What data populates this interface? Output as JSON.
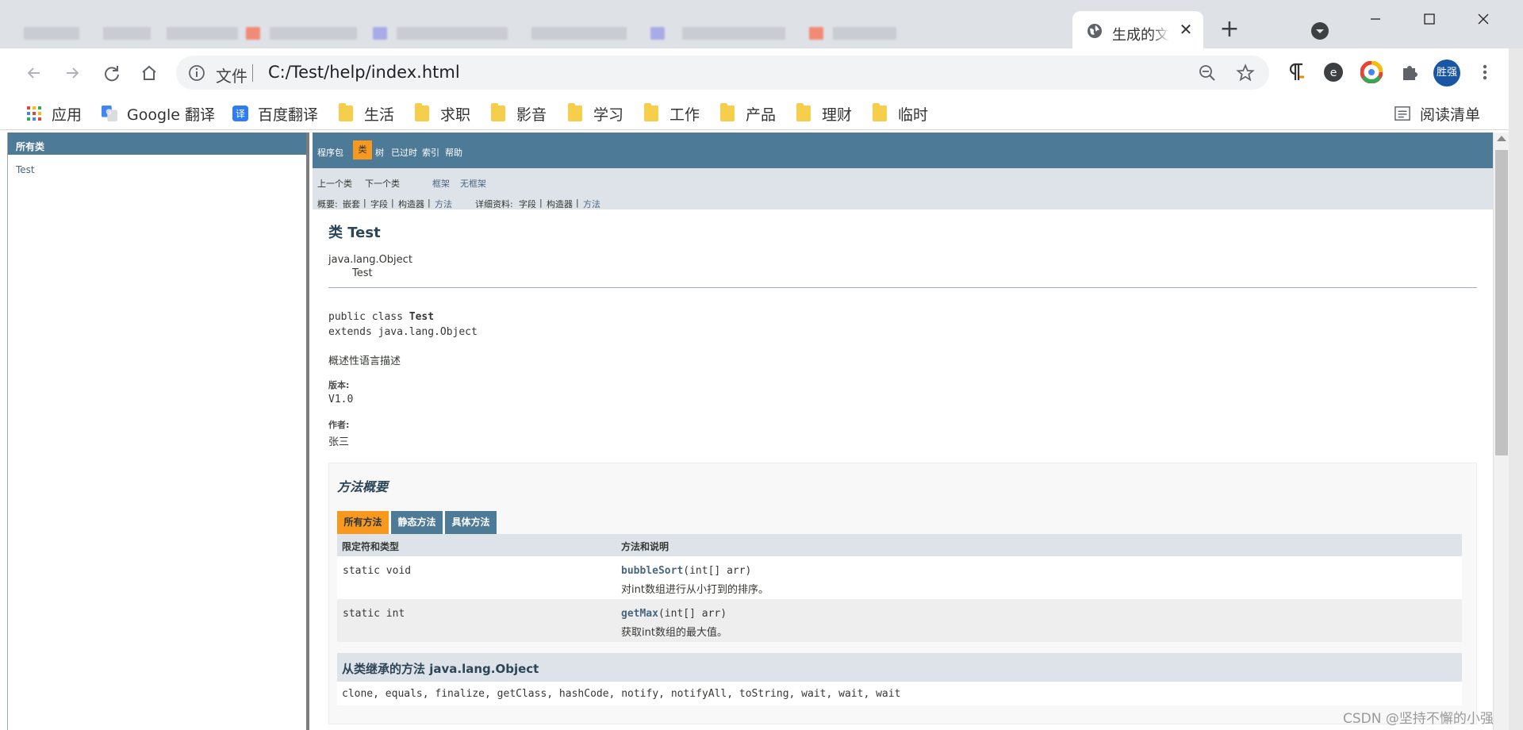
{
  "browser": {
    "tab_title": "生成的文",
    "tab_close": "✕",
    "new_tab": "+",
    "url_scheme": "文件",
    "url": "C:/Test/help/index.html",
    "profile_name": "胜强"
  },
  "bookmarks": [
    {
      "label": "应用",
      "icon": "apps-grid-icon"
    },
    {
      "label": "Google 翻译",
      "icon": "google-translate-icon"
    },
    {
      "label": "百度翻译",
      "icon": "baidu-translate-icon"
    },
    {
      "label": "生活",
      "icon": "folder-icon"
    },
    {
      "label": "求职",
      "icon": "folder-icon"
    },
    {
      "label": "影音",
      "icon": "folder-icon"
    },
    {
      "label": "学习",
      "icon": "folder-icon"
    },
    {
      "label": "工作",
      "icon": "folder-icon"
    },
    {
      "label": "产品",
      "icon": "folder-icon"
    },
    {
      "label": "理财",
      "icon": "folder-icon"
    },
    {
      "label": "临时",
      "icon": "folder-icon"
    }
  ],
  "reading_list": "阅读清单",
  "left_frame": {
    "header": "所有类",
    "classes": [
      "Test"
    ]
  },
  "javadoc": {
    "topnav": {
      "package": "程序包",
      "class": "类",
      "tree": "树",
      "deprecated": "已过时",
      "index": "索引",
      "help": "帮助"
    },
    "subnav": {
      "prev_class": "上一个类",
      "next_class": "下一个类",
      "frames": "框架",
      "no_frames": "无框架",
      "summary_label": "概要:",
      "summary_nested": "嵌套",
      "summary_field": "字段",
      "summary_constructor": "构造器",
      "summary_method": "方法",
      "detail_label": "详细资料:",
      "detail_field": "字段",
      "detail_constructor": "构造器",
      "detail_method": "方法",
      "sep": "|"
    },
    "class_title": "类 Test",
    "inheritance": [
      "java.lang.Object",
      "Test"
    ],
    "declaration_prefix": "public class",
    "declaration_name": "Test",
    "declaration_extends": "extends java.lang.Object",
    "description": "概述性语言描述",
    "version_label": "版本:",
    "version": "V1.0",
    "author_label": "作者:",
    "author": "张三",
    "method_summary": {
      "title": "方法概要",
      "tabs": [
        "所有方法",
        "静态方法",
        "具体方法"
      ],
      "col_modifier": "限定符和类型",
      "col_method": "方法和说明",
      "rows": [
        {
          "modifier": "static void",
          "name": "bubbleSort",
          "params": "(int[] arr)",
          "desc": "对int数组进行从小打到的排序。"
        },
        {
          "modifier": "static int",
          "name": "getMax",
          "params": "(int[] arr)",
          "desc": "获取int数组的最大值。"
        }
      ],
      "inherited_title": "从类继承的方法 java.lang.Object",
      "inherited_list": "clone, equals, finalize, getClass, hashCode, notify, notifyAll, toString, wait, wait, wait"
    }
  },
  "watermark": "CSDN @坚持不懈的小强",
  "colors": {
    "javadoc_nav": "#4d7a97",
    "javadoc_highlight": "#f8981d",
    "javadoc_subnav": "#dee3e9",
    "link": "#4a6782",
    "profile": "#1a56a4"
  }
}
